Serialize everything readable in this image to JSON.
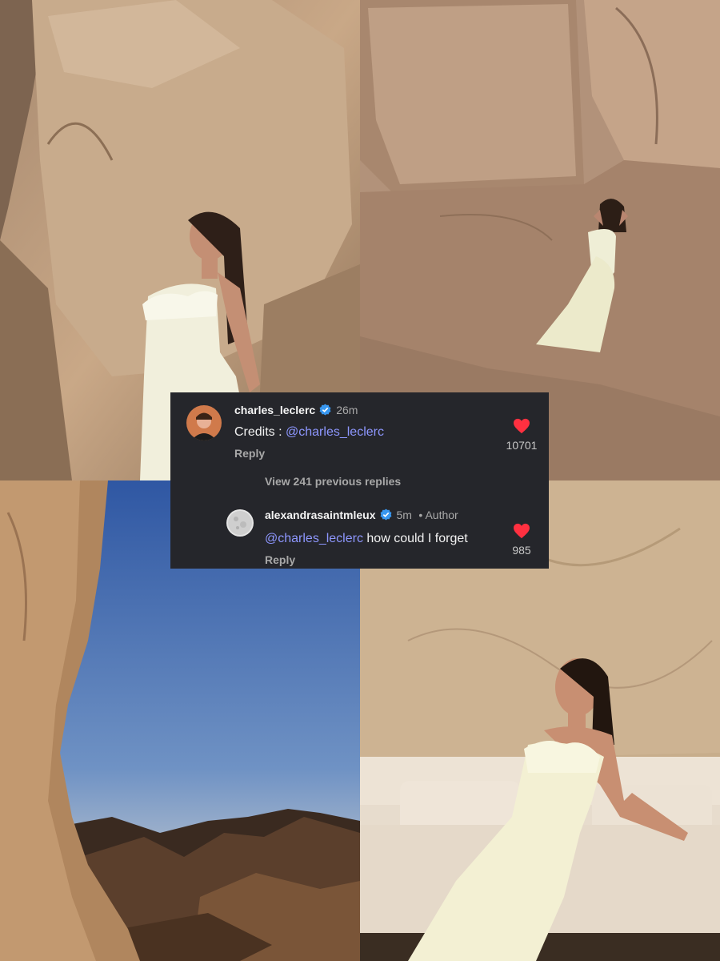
{
  "comments": [
    {
      "username": "charles_leclerc",
      "time": "26m",
      "text_prefix": "Credits : ",
      "mention": "@charles_leclerc",
      "text_suffix": "",
      "reply_label": "Reply",
      "likes": "10701",
      "verified": true
    },
    {
      "username": "alexandrasaintmleux",
      "time": "5m",
      "author_tag": "• Author",
      "mention": "@charles_leclerc",
      "text_suffix": " how could I forget",
      "reply_label": "Reply",
      "likes": "985",
      "verified": true
    }
  ],
  "view_replies_label": "View 241 previous replies",
  "colors": {
    "card_bg": "#25262b",
    "mention": "#8e97ff",
    "heart": "#ff3040",
    "verified": "#3897f0"
  }
}
